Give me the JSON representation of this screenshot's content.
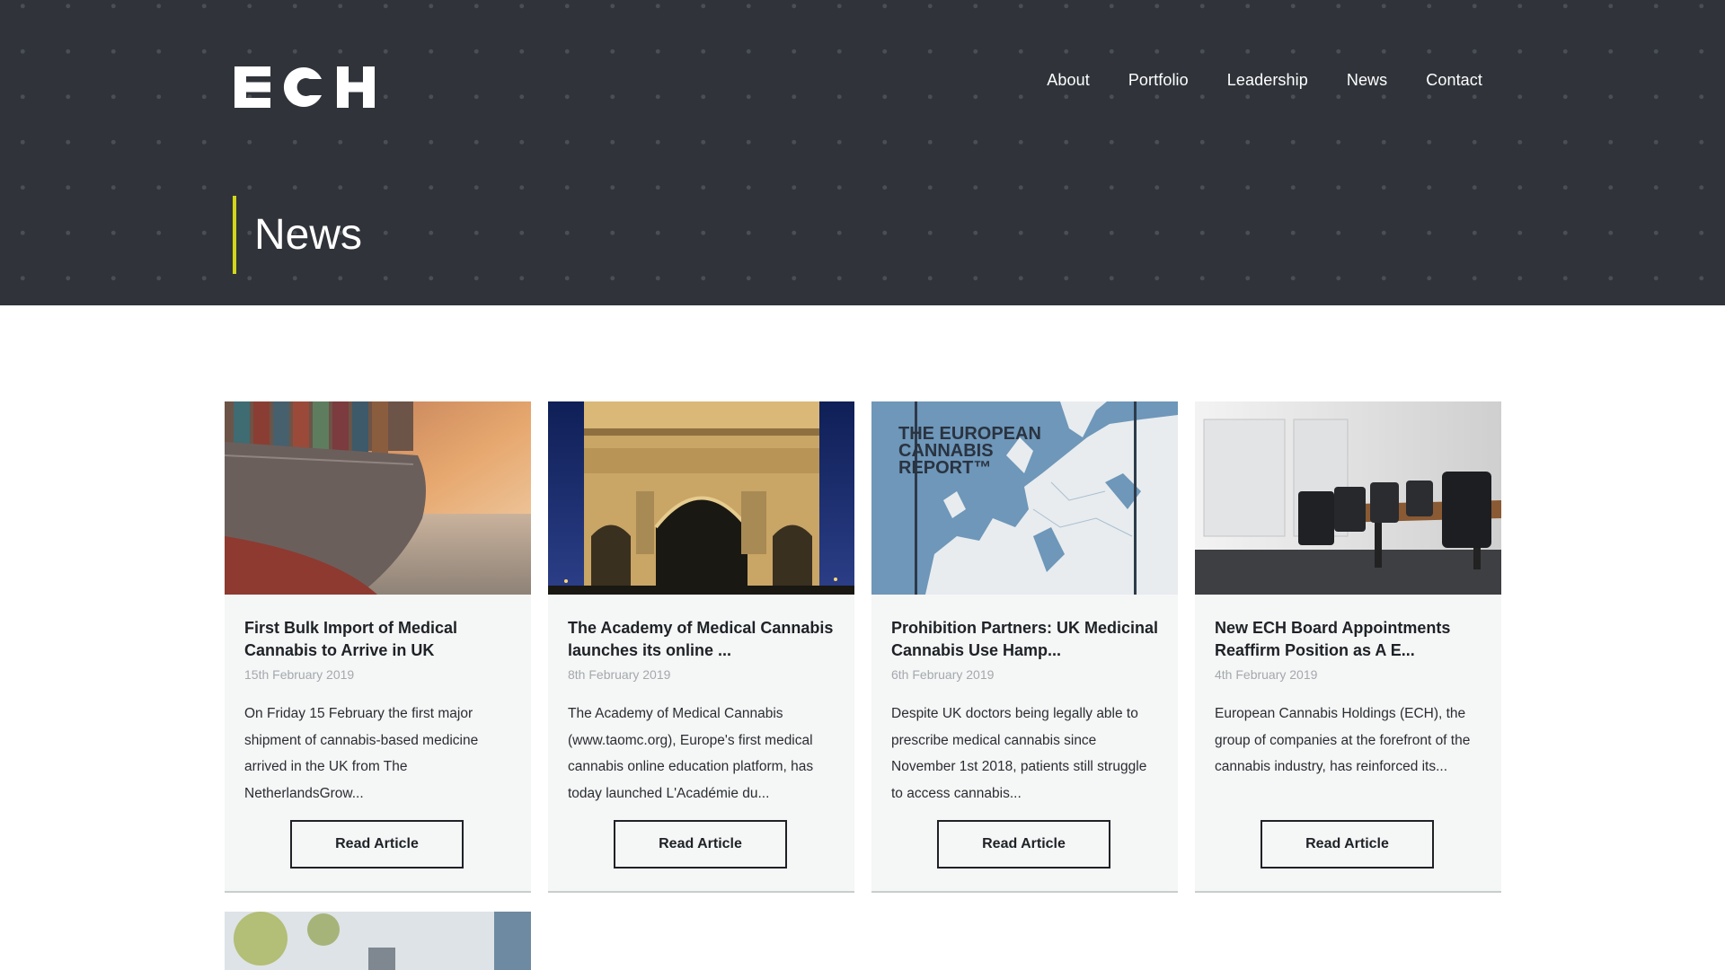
{
  "header": {
    "logo_text": "ECH",
    "nav": [
      "About",
      "Portfolio",
      "Leadership",
      "News",
      "Contact"
    ],
    "page_title": "News",
    "accent_color": "#d4d619",
    "background_color": "#30343a"
  },
  "articles": [
    {
      "title": "First Bulk Import of Medical Cannabis to Arrive in UK",
      "date": "15th February 2019",
      "excerpt": "On Friday 15 February the first major shipment of cannabis-based medicine arrived in the UK from The NetherlandsGrow...",
      "button": "Read Article",
      "image": "cargo-ship-image"
    },
    {
      "title": "The Academy of Medical Cannabis launches its online ...",
      "date": "8th February 2019",
      "excerpt": "The Academy of Medical Cannabis (www.taomc.org), Europe's first medical cannabis online education platform, has today launched L'Académie du...",
      "button": "Read Article",
      "image": "arc-de-triomphe-image"
    },
    {
      "title": "Prohibition Partners: UK Medicinal Cannabis Use Hamp...",
      "date": "6th February 2019",
      "excerpt": "Despite UK doctors being legally able to prescribe medical cannabis since November 1st 2018, patients still struggle to access cannabis...",
      "button": "Read Article",
      "image": "european-cannabis-report-image",
      "image_text": [
        "THE EUROPEAN",
        "CANNABIS",
        "REPORT™"
      ]
    },
    {
      "title": "New ECH Board Appointments Reaffirm Position as A E...",
      "date": "4th February 2019",
      "excerpt": "European Cannabis Holdings (ECH), the group of companies at the forefront of the cannabis industry, has reinforced its...",
      "button": "Read Article",
      "image": "boardroom-image"
    }
  ]
}
